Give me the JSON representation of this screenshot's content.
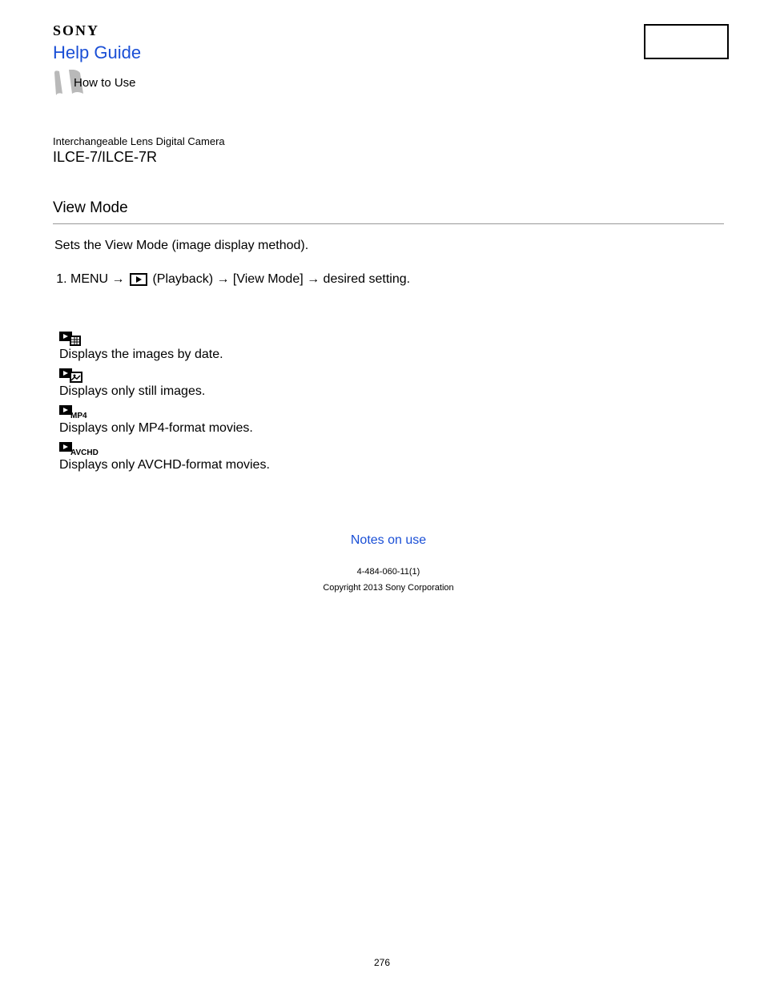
{
  "header": {
    "brand": "SONY",
    "help_guide": "Help Guide",
    "how_to_use": "How to Use"
  },
  "product": {
    "subtitle": "Interchangeable Lens Digital Camera",
    "model": "ILCE-7/ILCE-7R"
  },
  "section": {
    "title": "View Mode",
    "intro": "Sets the View Mode (image display method)."
  },
  "step": {
    "pre": "MENU → ",
    "after_icon": " (Playback) → [View Mode] → desired setting."
  },
  "modes": {
    "date": "Displays the images by date.",
    "still": "Displays only still images.",
    "mp4": "Displays only MP4-format movies.",
    "avchd": "Displays only AVCHD-format movies."
  },
  "footer": {
    "notes_link": "Notes on use",
    "doc_num": "4-484-060-11(1)",
    "copyright": "Copyright 2013 Sony Corporation"
  },
  "page_number": "276"
}
